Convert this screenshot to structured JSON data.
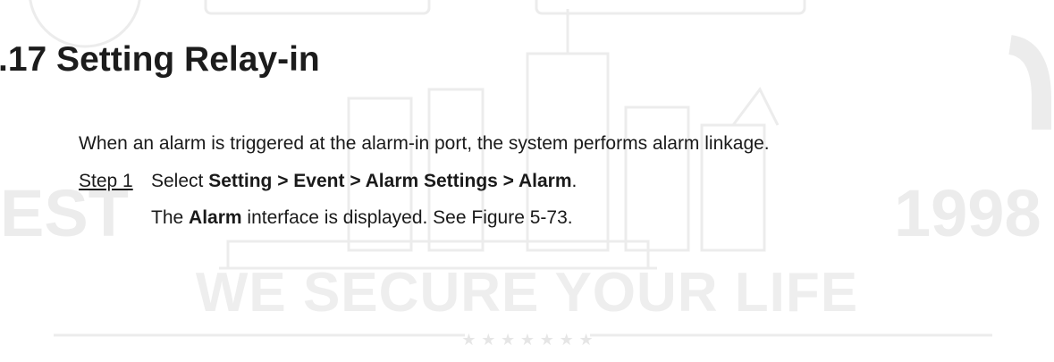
{
  "watermark": {
    "slogan": "WE SECURE YOUR LIFE",
    "prefix": "EST",
    "year": "1998"
  },
  "heading": ".17 Setting Relay-in",
  "intro": "When an alarm is triggered at the alarm-in port, the system performs alarm linkage.",
  "step1": {
    "label": "Step 1",
    "select_word": "Select ",
    "menu_path": "Setting > Event > Alarm Settings > Alarm",
    "period": "."
  },
  "result": {
    "prefix": "The ",
    "ui_name": "Alarm",
    "suffix": " interface is displayed. See Figure 5-73."
  }
}
